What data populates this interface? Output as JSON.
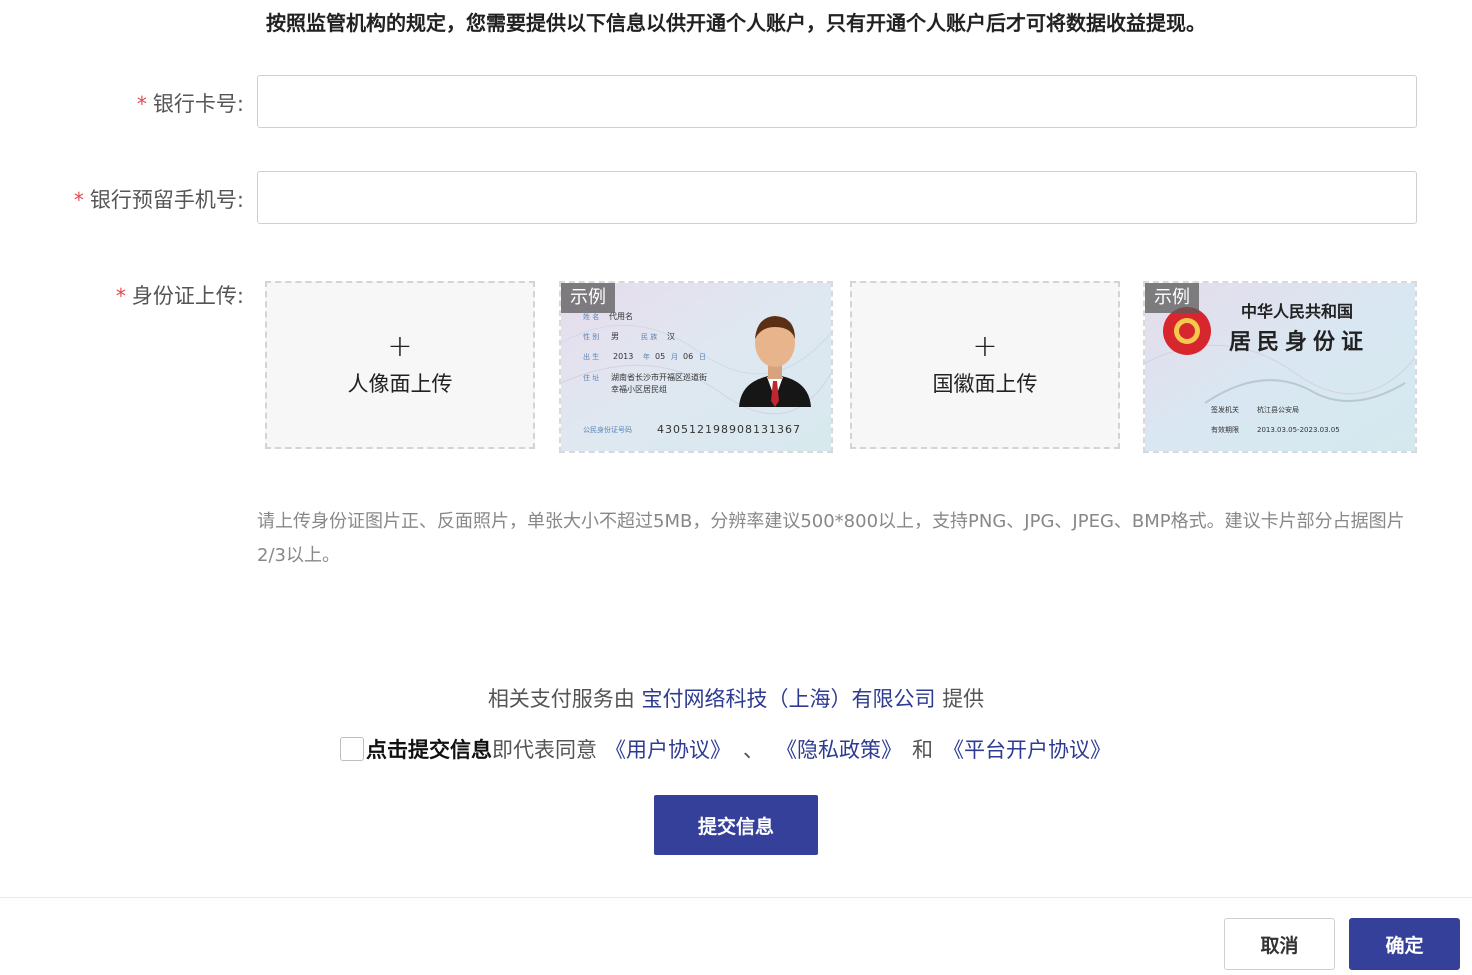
{
  "notice": "按照监管机构的规定，您需要提供以下信息以供开通个人账户，只有开通个人账户后才可将数据收益提现。",
  "form": {
    "bank_card": {
      "required_mark": "*",
      "label": "银行卡号:",
      "value": "",
      "placeholder": ""
    },
    "phone": {
      "required_mark": "*",
      "label": "银行预留手机号:",
      "value": "",
      "placeholder": ""
    },
    "id_upload": {
      "required_mark": "*",
      "label": "身份证上传:",
      "portrait_box": {
        "icon": "+",
        "text": "人像面上传"
      },
      "emblem_box": {
        "icon": "+",
        "text": "国徽面上传"
      },
      "sample_badge": "示例",
      "sample_front": {
        "name_label": "姓 名",
        "name_value": "代用名",
        "gender_label": "性 别",
        "gender_value": "男",
        "ethnicity_label": "民 族",
        "ethnicity_value": "汉",
        "birth_label": "出 生",
        "birth_year": "2013",
        "year_unit": "年",
        "birth_month": "05",
        "month_unit": "月",
        "birth_day": "06",
        "day_unit": "日",
        "address_label": "住 址",
        "address_line1": "湖南省长沙市开福区巡道街",
        "address_line2": "幸福小区居民组",
        "id_label": "公民身份证号码",
        "id_number": "430512198908131367"
      },
      "sample_back": {
        "title1": "中华人民共和国",
        "title2": "居民身份证",
        "authority_label": "签发机关",
        "authority_value": "杭江县公安局",
        "validity_label": "有效期限",
        "validity_value": "2013.03.05-2023.03.05"
      },
      "hint": "请上传身份证图片正、反面照片，单张大小不超过5MB，分辨率建议500*800以上，支持PNG、JPG、JPEG、BMP格式。建议卡片部分占据图片2/3以上。"
    }
  },
  "provider": {
    "prefix": "相关支付服务由",
    "company": "宝付网络科技（上海）有限公司",
    "suffix": "提供"
  },
  "agreement": {
    "strong": "点击提交信息",
    "text": "即代表同意",
    "user_agreement": "《用户协议》",
    "sep1": "、",
    "privacy": "《隐私政策》",
    "and": "和",
    "platform": "《平台开户协议》",
    "checked": false
  },
  "submit_label": "提交信息",
  "footer": {
    "cancel_label": "取消",
    "confirm_label": "确定"
  },
  "colors": {
    "primary": "#35409a",
    "link": "#2e3b92",
    "required": "#e5484d"
  }
}
